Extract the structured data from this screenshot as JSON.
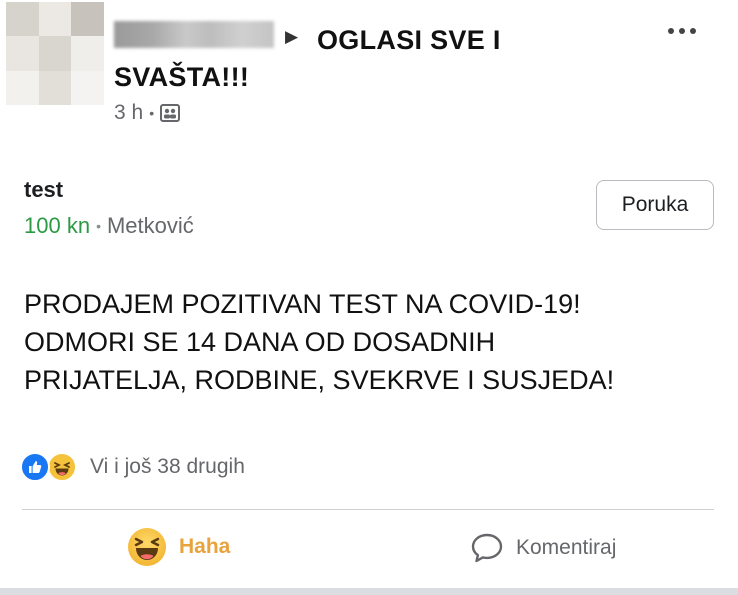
{
  "post": {
    "group_name": "OGLASI  SVE I SVAŠTA!!!",
    "time": "3 h",
    "separator": "•"
  },
  "listing": {
    "title": "test",
    "price": "100 kn",
    "separator": "•",
    "location": "Metković",
    "message_button": "Poruka"
  },
  "body_lines": [
    "PRODAJEM POZITIVAN TEST NA COVID-19!",
    "ODMORI SE 14 DANA OD DOSADNIH",
    "PRIJATELJA, RODBINE, SVEKRVE I SUSJEDA!"
  ],
  "reactions": {
    "summary": "Vi i još 38 drugih",
    "icons": [
      "like-icon",
      "haha-icon"
    ]
  },
  "actions": {
    "haha_label": "Haha",
    "comment_label": "Komentiraj"
  },
  "colors": {
    "price_green": "#2c9a44",
    "haha_orange": "#e8a33d",
    "like_blue": "#1877f2",
    "secondary_text": "#65676b"
  }
}
